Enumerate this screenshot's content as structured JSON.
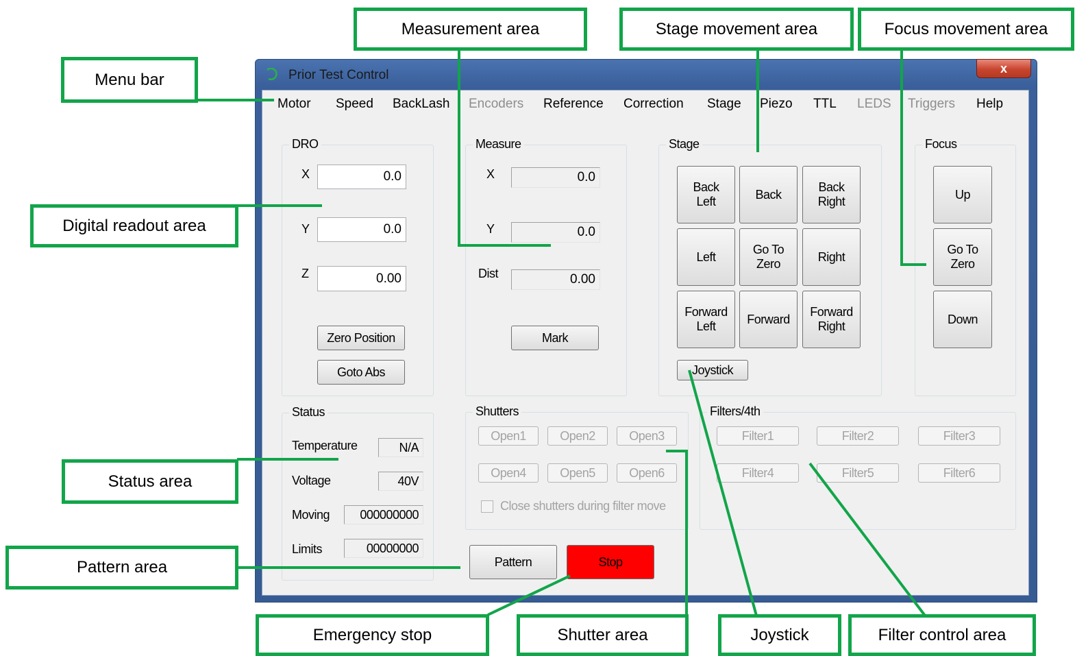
{
  "window": {
    "title": "Prior Test Control",
    "close_glyph": "x"
  },
  "menu": [
    {
      "label": "Motor",
      "enabled": true
    },
    {
      "label": "Speed",
      "enabled": true
    },
    {
      "label": "BackLash",
      "enabled": true
    },
    {
      "label": "Encoders",
      "enabled": false
    },
    {
      "label": "Reference",
      "enabled": true
    },
    {
      "label": "Correction",
      "enabled": true
    },
    {
      "label": "Stage",
      "enabled": true
    },
    {
      "label": "Piezo",
      "enabled": true
    },
    {
      "label": "TTL",
      "enabled": true
    },
    {
      "label": "LEDS",
      "enabled": false
    },
    {
      "label": "Triggers",
      "enabled": false
    },
    {
      "label": "Help",
      "enabled": true
    }
  ],
  "dro": {
    "title": "DRO",
    "x_label": "X",
    "x_value": "0.0",
    "y_label": "Y",
    "y_value": "0.0",
    "z_label": "Z",
    "z_value": "0.00",
    "zero_position": "Zero Position",
    "goto_abs": "Goto Abs"
  },
  "measure": {
    "title": "Measure",
    "x_label": "X",
    "x_value": "0.0",
    "y_label": "Y",
    "y_value": "0.0",
    "dist_label": "Dist",
    "dist_value": "0.00",
    "mark": "Mark"
  },
  "stage": {
    "title": "Stage",
    "back_left": "Back\nLeft",
    "back": "Back",
    "back_right": "Back\nRight",
    "left": "Left",
    "go_to_zero": "Go To\nZero",
    "right": "Right",
    "forward_left": "Forward\nLeft",
    "forward": "Forward",
    "forward_right": "Forward\nRight",
    "joystick": "Joystick"
  },
  "focus": {
    "title": "Focus",
    "up": "Up",
    "go_to_zero": "Go To\nZero",
    "down": "Down"
  },
  "status": {
    "title": "Status",
    "temperature_label": "Temperature",
    "temperature_value": "N/A",
    "voltage_label": "Voltage",
    "voltage_value": "40V",
    "moving_label": "Moving",
    "moving_value": "000000000",
    "limits_label": "Limits",
    "limits_value": "00000000"
  },
  "shutters": {
    "title": "Shutters",
    "open1": "Open1",
    "open2": "Open2",
    "open3": "Open3",
    "open4": "Open4",
    "open5": "Open5",
    "open6": "Open6",
    "close_during_move": "Close shutters during filter move",
    "close_during_move_checked": false
  },
  "filters": {
    "title": "Filters/4th",
    "filter1": "Filter1",
    "filter2": "Filter2",
    "filter3": "Filter3",
    "filter4": "Filter4",
    "filter5": "Filter5",
    "filter6": "Filter6"
  },
  "actions": {
    "pattern": "Pattern",
    "stop": "Stop",
    "stop_color": "#ff0000"
  },
  "callouts": {
    "menu_bar": "Menu bar",
    "measurement_area": "Measurement area",
    "stage_movement_area": "Stage movement area",
    "focus_movement_area": "Focus movement area",
    "digital_readout_area": "Digital readout area",
    "status_area": "Status area",
    "pattern_area": "Pattern area",
    "emergency_stop": "Emergency stop",
    "shutter_area": "Shutter area",
    "joystick": "Joystick",
    "filter_control_area": "Filter control area"
  },
  "callout_color": "#12a54a"
}
